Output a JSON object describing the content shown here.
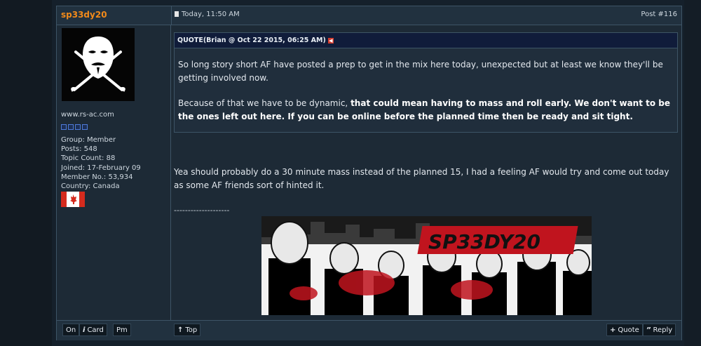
{
  "author": {
    "name": "sp33dy20",
    "site": "www.rs-ac.com",
    "info": {
      "group": "Group: Member",
      "posts": "Posts: 548",
      "topics": "Topic Count: 88",
      "joined": "Joined: 17-February 09",
      "member_no": "Member No.: 53,934",
      "country": "Country: Canada"
    }
  },
  "post": {
    "date": "Today, 11:50 AM",
    "number": "Post #116",
    "quote": {
      "header": "QUOTE(Brian @ Oct 22 2015, 06:25 AM)",
      "p1": "So long story short AF have posted a prep to get in the mix here today, unexpected but at least we know they'll be getting involved now.",
      "p2_normal": "Because of that we have to be dynamic, ",
      "p2_bold": "that could mean having to mass and roll early. We don't want to be the ones left out here. If you can be online before the planned time then be ready and sit tight."
    },
    "reply": "Yea should probably do a 30 minute mass instead of the planned 15, I had a feeling AF would try and come out today as some AF friends sort of hinted it.",
    "signature_divider": "--------------------",
    "banner_text": "SP33DY20"
  },
  "footer": {
    "on": "On",
    "card": "Card",
    "pm": "Pm",
    "top": "Top",
    "quote": "Quote",
    "reply": "Reply"
  },
  "colors": {
    "username": "#f28a1a",
    "quote_header": "#101c3a",
    "banner_red": "#c0141e"
  }
}
